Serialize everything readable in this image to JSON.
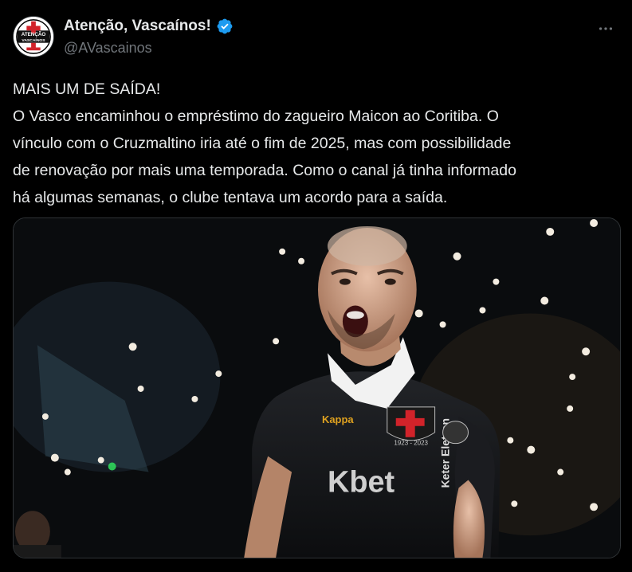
{
  "author": {
    "display_name": "Atenção, Vascaínos!",
    "handle": "@AVascainos",
    "avatar_text": "ATENÇÃO VASCAÍNOS",
    "verified": true
  },
  "tweet": {
    "lines": [
      "MAIS UM DE SAÍDA!",
      "O Vasco encaminhou o empréstimo do zagueiro Maicon ao Coritiba. O",
      "vínculo com o Cruzmaltino iria até o fim de 2025, mas com possibilidade",
      "de renovação por mais uma temporada. Como o canal já tinha informado",
      "há algumas semanas, o clube tentava um acordo para a saída."
    ]
  },
  "media": {
    "jersey_text": "Kbet",
    "jersey_brand": "Kappa",
    "patch_years": "1923 - 2023",
    "sleeve_text": "Keter Eletron"
  },
  "colors": {
    "background": "#000000",
    "text": "#e7e9ea",
    "secondary": "#71767b",
    "verified": "#1d9bf0",
    "vasco_red": "#d2232a"
  },
  "icons": {
    "verified": "verified-badge-icon",
    "more": "more-options-icon"
  }
}
